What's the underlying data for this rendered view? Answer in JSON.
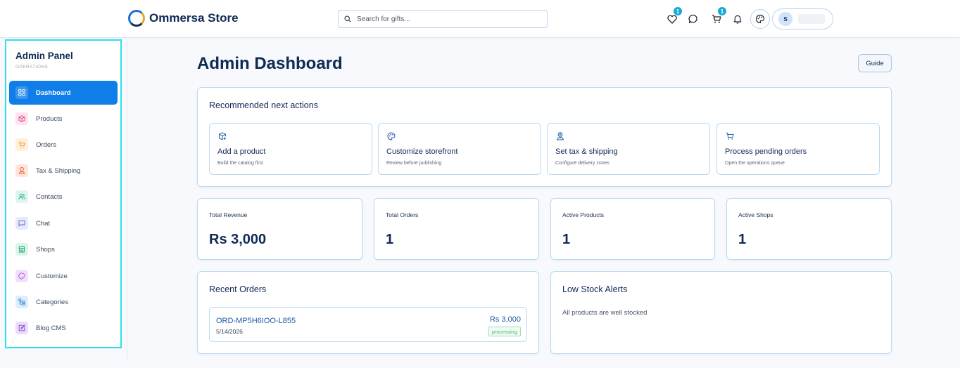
{
  "header": {
    "brand_name": "Ommersa Store",
    "search_placeholder": "Search for gifts...",
    "wishlist_count": "1",
    "cart_count": "1",
    "avatar_initial": "S"
  },
  "sidebar": {
    "title": "Admin Panel",
    "subtitle": "OPERATIONS",
    "items": [
      {
        "label": "Dashboard",
        "icon": "grid-icon",
        "active": true
      },
      {
        "label": "Products",
        "icon": "box-icon"
      },
      {
        "label": "Orders",
        "icon": "cart-icon"
      },
      {
        "label": "Tax & Shipping",
        "icon": "map-pin-icon"
      },
      {
        "label": "Contacts",
        "icon": "users-icon"
      },
      {
        "label": "Chat",
        "icon": "chat-icon"
      },
      {
        "label": "Shops",
        "icon": "store-icon"
      },
      {
        "label": "Customize",
        "icon": "palette-icon"
      },
      {
        "label": "Categories",
        "icon": "tree-icon"
      },
      {
        "label": "Blog CMS",
        "icon": "edit-icon"
      }
    ]
  },
  "main": {
    "title": "Admin Dashboard",
    "guide_label": "Guide",
    "recommended": {
      "heading": "Recommended next actions",
      "actions": [
        {
          "title": "Add a product",
          "desc": "Build the catalog first"
        },
        {
          "title": "Customize storefront",
          "desc": "Review before publishing"
        },
        {
          "title": "Set tax & shipping",
          "desc": "Configure delivery zones"
        },
        {
          "title": "Process pending orders",
          "desc": "Open the operations queue"
        }
      ]
    },
    "stats": [
      {
        "label": "Total Revenue",
        "value": "Rs 3,000"
      },
      {
        "label": "Total Orders",
        "value": "1"
      },
      {
        "label": "Active Products",
        "value": "1"
      },
      {
        "label": "Active Shops",
        "value": "1"
      }
    ],
    "recent_orders": {
      "heading": "Recent Orders",
      "orders": [
        {
          "id": "ORD-MP5H6IOO-L855",
          "date": "5/14/2026",
          "amount": "Rs 3,000",
          "status": "processing"
        }
      ]
    },
    "low_stock": {
      "heading": "Low Stock Alerts",
      "message": "All products are well stocked"
    }
  },
  "colors": {
    "primary": "#0f7ee8",
    "navy": "#0f2a55",
    "sidebar_border": "#2ee0e8",
    "badge": "#18a9d6",
    "status_green": "#49b874"
  }
}
